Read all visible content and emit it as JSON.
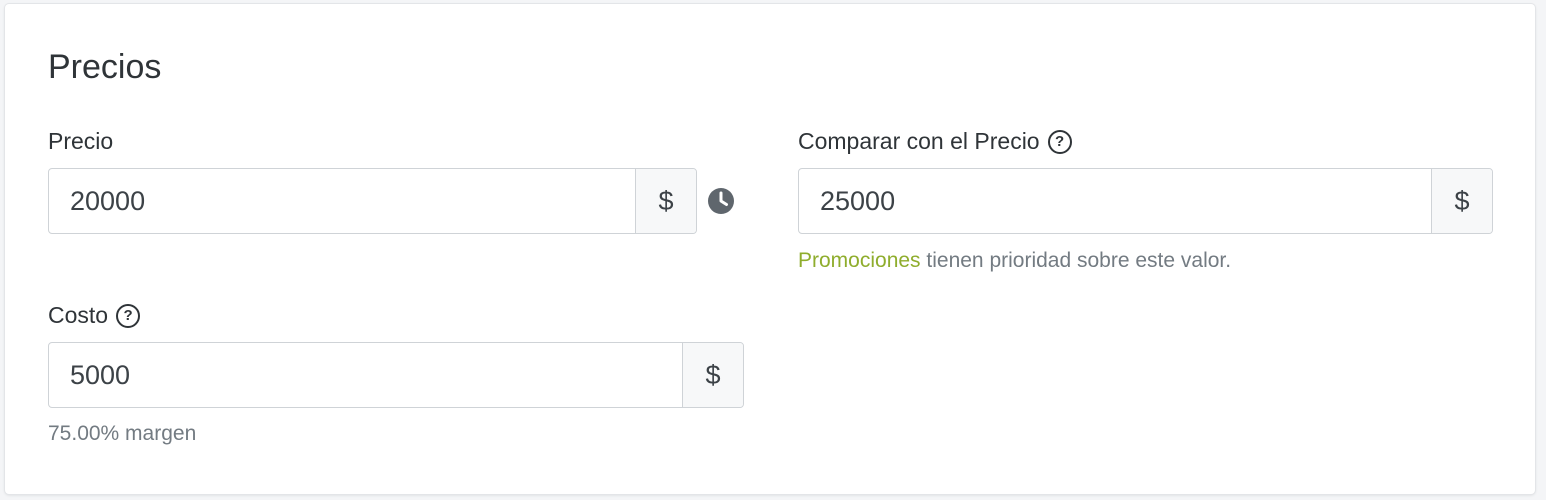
{
  "section": {
    "title": "Precios"
  },
  "price": {
    "label": "Precio",
    "value": "20000",
    "currency": "$",
    "schedule_icon": "clock-icon"
  },
  "compare_price": {
    "label": "Comparar con el Precio",
    "help_icon": "question-circle-icon",
    "help_glyph": "?",
    "value": "25000",
    "currency": "$",
    "hint_link": "Promociones",
    "hint_text": " tienen prioridad sobre este valor."
  },
  "cost": {
    "label": "Costo",
    "help_icon": "question-circle-icon",
    "help_glyph": "?",
    "value": "5000",
    "currency": "$",
    "margin_text": "75.00% margen"
  },
  "colors": {
    "link_green": "#8fad2d",
    "text": "#2f3438",
    "muted": "#737b82",
    "clock_gray": "#5f666d"
  }
}
